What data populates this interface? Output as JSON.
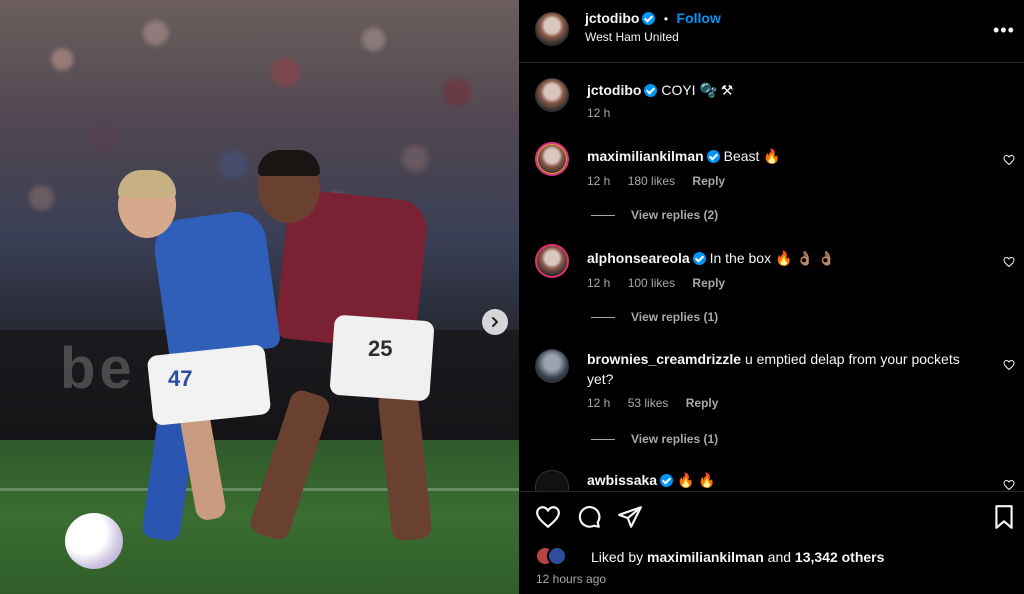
{
  "post": {
    "author": "jctodibo",
    "follow_label": "Follow",
    "dot": "•",
    "location": "West Ham United",
    "more_icon": "more-options-icon",
    "caption_text": "COYI",
    "caption_emoji": "🫧 ⚒",
    "caption_time": "12 h",
    "board_text": "be"
  },
  "photo": {
    "home_shirt_number": "47",
    "away_shirt_number": "25",
    "next_icon": "chevron-right-icon"
  },
  "comments": [
    {
      "user": "maximiliankilman",
      "text": "Beast 🔥",
      "time": "12 h",
      "likes": "180 likes",
      "reply": "Reply",
      "view_replies": "View replies (2)"
    },
    {
      "user": "alphonseareola",
      "text": "In the box 🔥 👌🏽 👌🏽",
      "time": "12 h",
      "likes": "100 likes",
      "reply": "Reply",
      "view_replies": "View replies (1)"
    },
    {
      "user": "brownies_creamdrizzle",
      "text": "u emptied delap from your pockets yet?",
      "time": "12 h",
      "likes": "53 likes",
      "reply": "Reply",
      "view_replies": "View replies (1)"
    },
    {
      "user": "awbissaka",
      "text": "🔥 🔥"
    }
  ],
  "footer": {
    "liked_prefix": "Liked by",
    "liked_user": "maximiliankilman",
    "liked_and": "and",
    "liked_count": "13,342 others",
    "time_ago": "12 hours ago"
  },
  "colors": {
    "accent_blue": "#0095f6",
    "muted_text": "#a8a8a8",
    "background": "#000000"
  }
}
